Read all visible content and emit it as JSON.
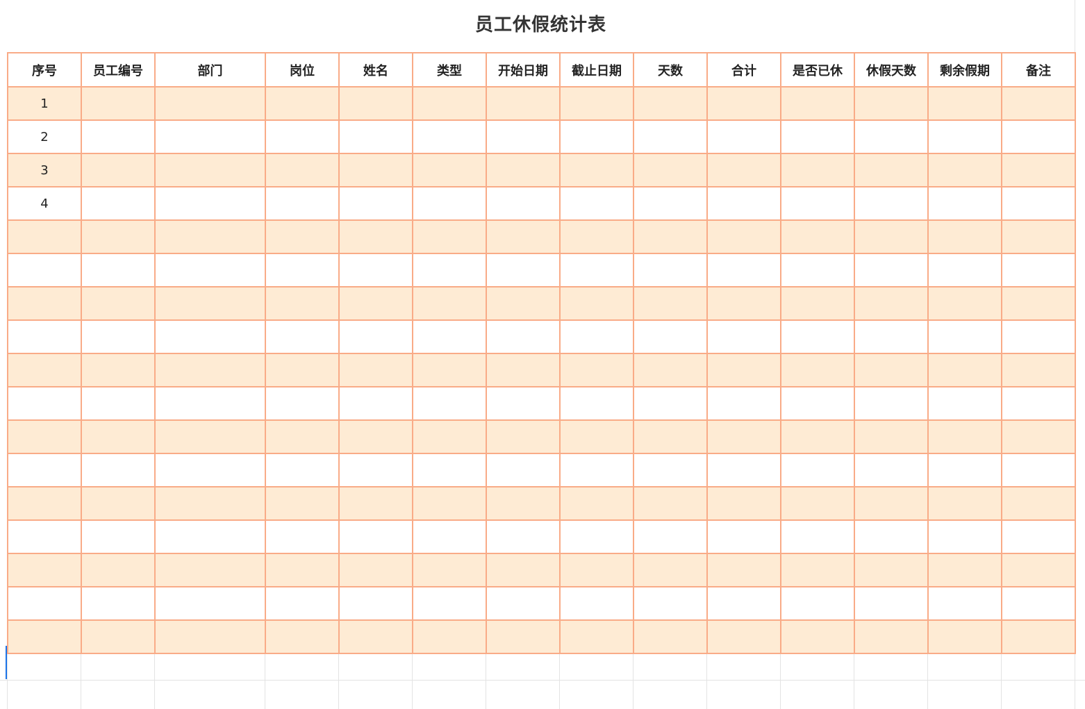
{
  "sheet": {
    "title": "员工休假统计表",
    "headers": [
      "序号",
      "员工编号",
      "部门",
      "岗位",
      "姓名",
      "类型",
      "开始日期",
      "截止日期",
      "天数",
      "合计",
      "是否已休",
      "休假天数",
      "剩余假期",
      "备注"
    ],
    "rows": [
      [
        "1",
        "",
        "",
        "",
        "",
        "",
        "",
        "",
        "",
        "",
        "",
        "",
        "",
        ""
      ],
      [
        "2",
        "",
        "",
        "",
        "",
        "",
        "",
        "",
        "",
        "",
        "",
        "",
        "",
        ""
      ],
      [
        "3",
        "",
        "",
        "",
        "",
        "",
        "",
        "",
        "",
        "",
        "",
        "",
        "",
        ""
      ],
      [
        "4",
        "",
        "",
        "",
        "",
        "",
        "",
        "",
        "",
        "",
        "",
        "",
        "",
        ""
      ],
      [
        "",
        "",
        "",
        "",
        "",
        "",
        "",
        "",
        "",
        "",
        "",
        "",
        "",
        ""
      ],
      [
        "",
        "",
        "",
        "",
        "",
        "",
        "",
        "",
        "",
        "",
        "",
        "",
        "",
        ""
      ],
      [
        "",
        "",
        "",
        "",
        "",
        "",
        "",
        "",
        "",
        "",
        "",
        "",
        "",
        ""
      ],
      [
        "",
        "",
        "",
        "",
        "",
        "",
        "",
        "",
        "",
        "",
        "",
        "",
        "",
        ""
      ],
      [
        "",
        "",
        "",
        "",
        "",
        "",
        "",
        "",
        "",
        "",
        "",
        "",
        "",
        ""
      ],
      [
        "",
        "",
        "",
        "",
        "",
        "",
        "",
        "",
        "",
        "",
        "",
        "",
        "",
        ""
      ],
      [
        "",
        "",
        "",
        "",
        "",
        "",
        "",
        "",
        "",
        "",
        "",
        "",
        "",
        ""
      ],
      [
        "",
        "",
        "",
        "",
        "",
        "",
        "",
        "",
        "",
        "",
        "",
        "",
        "",
        ""
      ],
      [
        "",
        "",
        "",
        "",
        "",
        "",
        "",
        "",
        "",
        "",
        "",
        "",
        "",
        ""
      ],
      [
        "",
        "",
        "",
        "",
        "",
        "",
        "",
        "",
        "",
        "",
        "",
        "",
        "",
        ""
      ],
      [
        "",
        "",
        "",
        "",
        "",
        "",
        "",
        "",
        "",
        "",
        "",
        "",
        "",
        ""
      ],
      [
        "",
        "",
        "",
        "",
        "",
        "",
        "",
        "",
        "",
        "",
        "",
        "",
        "",
        ""
      ],
      [
        "",
        "",
        "",
        "",
        "",
        "",
        "",
        "",
        "",
        "",
        "",
        "",
        "",
        ""
      ]
    ]
  },
  "colors": {
    "border": "#f9ab87",
    "shaded_row": "#feebd4",
    "grid": "#e3e3e3",
    "cursor": "#1a73e8"
  }
}
